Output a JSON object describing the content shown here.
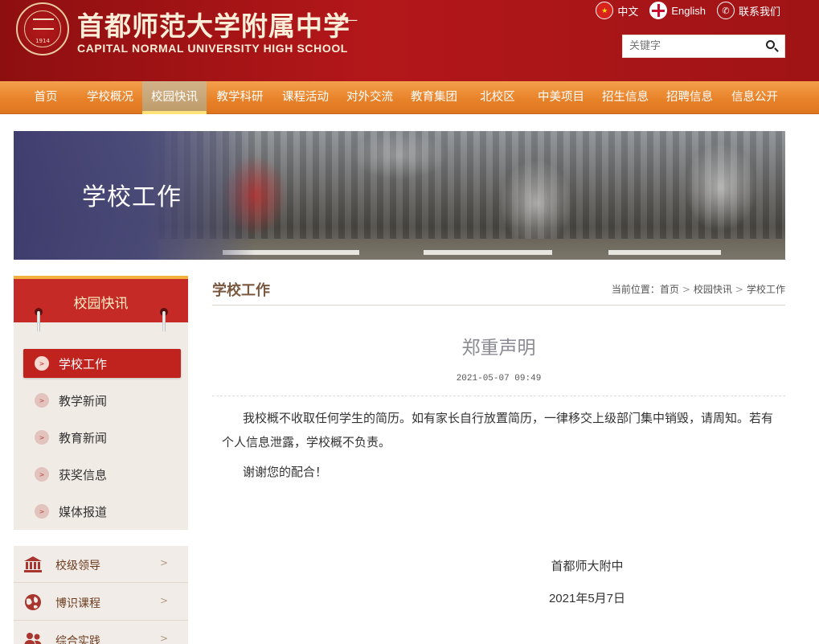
{
  "header": {
    "logo_cn": "首都师范大学附属中学",
    "logo_en": "CAPITAL NORMAL UNIVERSITY HIGH SCHOOL",
    "logo_seal_year": "1914",
    "logo_sub": "十一",
    "top_links": [
      {
        "label": "中文",
        "icon": "china-flag-icon"
      },
      {
        "label": "English",
        "icon": "uk-flag-icon"
      },
      {
        "label": "联系我们",
        "icon": "phone-icon"
      }
    ],
    "search": {
      "placeholder": "关键字"
    }
  },
  "nav": {
    "items": [
      {
        "label": "首页"
      },
      {
        "label": "学校概况"
      },
      {
        "label": "校园快讯"
      },
      {
        "label": "教学科研"
      },
      {
        "label": "课程活动"
      },
      {
        "label": "对外交流"
      },
      {
        "label": "教育集团"
      },
      {
        "label": "北校区"
      },
      {
        "label": "中美项目"
      },
      {
        "label": "招生信息"
      },
      {
        "label": "招聘信息"
      },
      {
        "label": "信息公开"
      }
    ],
    "active_index": 2
  },
  "banner": {
    "title": "学校工作"
  },
  "sidebar": {
    "header": "校园快讯",
    "items": [
      {
        "label": "学校工作"
      },
      {
        "label": "教学新闻"
      },
      {
        "label": "教育新闻"
      },
      {
        "label": "获奖信息"
      },
      {
        "label": "媒体报道"
      }
    ],
    "active_index": 0,
    "links": [
      {
        "label": "校级领导",
        "icon": "building-icon",
        "arrow": ">"
      },
      {
        "label": "博识课程",
        "icon": "globe-icon",
        "arrow": ">"
      },
      {
        "label": "综合实践",
        "icon": "people-icon",
        "arrow": ">"
      }
    ]
  },
  "content": {
    "title": "学校工作",
    "breadcrumb": {
      "prefix": "当前位置：",
      "items": [
        "首页",
        "校园快讯",
        "学校工作"
      ],
      "separator": ">"
    },
    "article": {
      "title": "郑重声明",
      "date": "2021-05-07 09:49",
      "paragraphs": [
        "我校概不收取任何学生的简历。如有家长自行放置简历，一律移交上级部门集中销毁，请周知。若有个人信息泄露，学校概不负责。",
        "谢谢您的配合！"
      ],
      "signature": "首都师大附中",
      "sign_date": "2021年5月7日"
    }
  },
  "colors": {
    "header_red": "#a01416",
    "nav_orange": "#e8832a",
    "sidebar_red": "#c62a26",
    "accent_gold": "#f2b13c"
  }
}
